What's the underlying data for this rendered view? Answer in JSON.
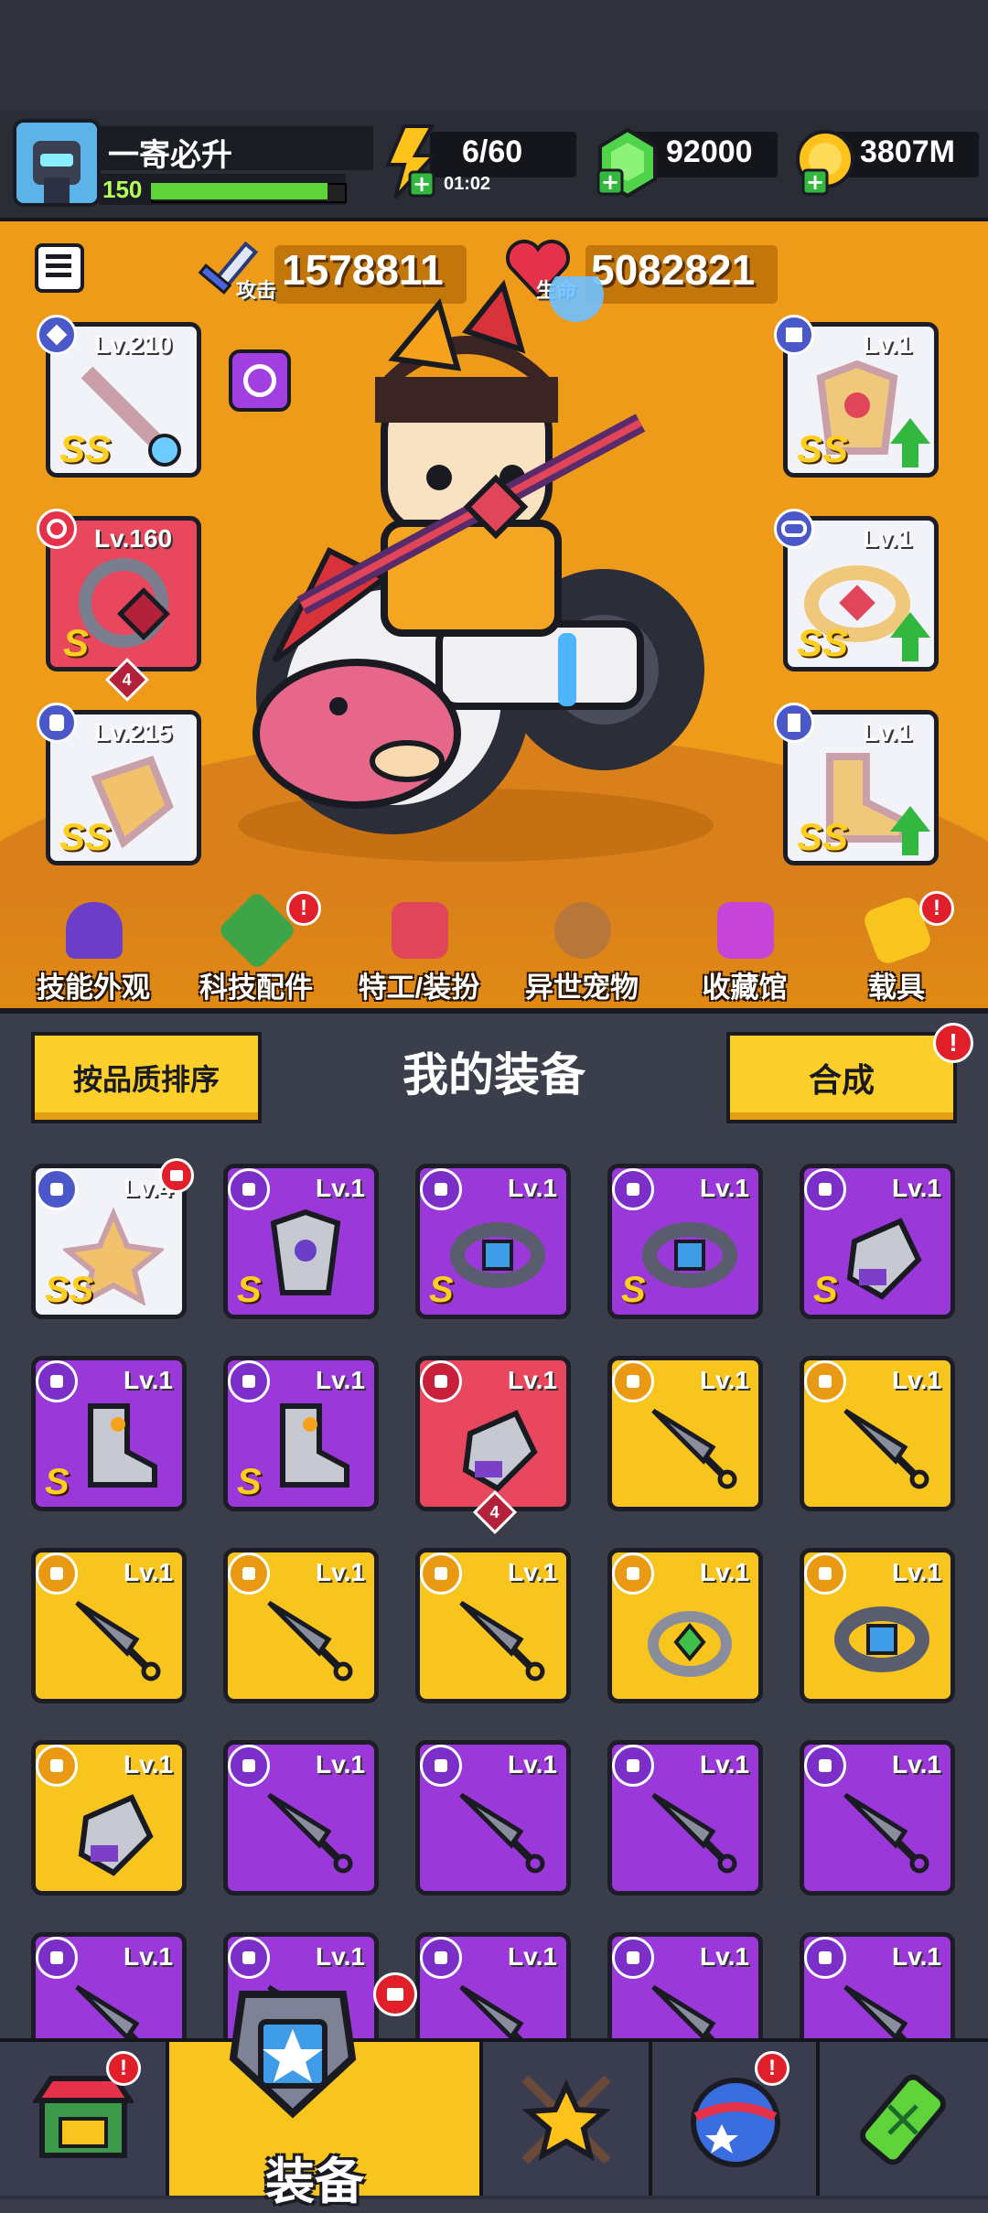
{
  "player": {
    "name": "一寄必升",
    "level": "150",
    "xp_progress": 0.92
  },
  "resources": {
    "energy": "6/60",
    "energy_timer": "01:02",
    "gems": "92000",
    "coins": "3807M"
  },
  "hero": {
    "attack_label": "攻击",
    "attack_value": "1578811",
    "hp_label": "生命",
    "hp_value": "5082821"
  },
  "equipped_slots": [
    {
      "level": "Lv.210",
      "grade": "SS",
      "icon": "sword-icon"
    },
    {
      "level": "Lv.160",
      "grade": "S",
      "stars": "4",
      "icon": "necklace-icon"
    },
    {
      "level": "Lv.215",
      "grade": "SS",
      "icon": "glove-icon"
    },
    {
      "level": "Lv.1",
      "grade": "SS",
      "icon": "armor-icon"
    },
    {
      "level": "Lv.1",
      "grade": "SS",
      "icon": "belt-icon"
    },
    {
      "level": "Lv.1",
      "grade": "SS",
      "icon": "boot-icon"
    }
  ],
  "features": [
    {
      "label": "技能外观",
      "icon": "hat-icon"
    },
    {
      "label": "科技配件",
      "icon": "hex-chip-icon",
      "alert": "!"
    },
    {
      "label": "特工/装扮",
      "icon": "agent-icon"
    },
    {
      "label": "异世宠物",
      "icon": "pet-icon"
    },
    {
      "label": "收藏馆",
      "icon": "treasure-chest-icon"
    },
    {
      "label": "载具",
      "icon": "skateboard-icon",
      "alert": "!"
    }
  ],
  "section": {
    "sort_button": "按品质排序",
    "title": "我的装备",
    "merge_button": "合成",
    "merge_alert": "!"
  },
  "inventory": [
    {
      "level": "Lv.4",
      "grade": "SS",
      "color": "white",
      "icon": "necklace-icon",
      "star": "alert"
    },
    {
      "level": "Lv.1",
      "grade": "S",
      "color": "purple",
      "icon": "armor-icon"
    },
    {
      "level": "Lv.1",
      "grade": "S",
      "color": "purple",
      "icon": "belt-icon"
    },
    {
      "level": "Lv.1",
      "grade": "S",
      "color": "purple",
      "icon": "belt-icon"
    },
    {
      "level": "Lv.1",
      "grade": "S",
      "color": "purple",
      "icon": "glove-icon"
    },
    {
      "level": "Lv.1",
      "grade": "S",
      "color": "purple",
      "icon": "boot-icon"
    },
    {
      "level": "Lv.1",
      "grade": "S",
      "color": "purple",
      "icon": "boot-icon"
    },
    {
      "level": "Lv.1",
      "grade": "",
      "color": "red",
      "icon": "glove-icon",
      "stars": "4"
    },
    {
      "level": "Lv.1",
      "grade": "",
      "color": "yellow",
      "icon": "kunai-icon"
    },
    {
      "level": "Lv.1",
      "grade": "",
      "color": "yellow",
      "icon": "kunai-icon"
    },
    {
      "level": "Lv.1",
      "grade": "",
      "color": "yellow",
      "icon": "kunai-icon"
    },
    {
      "level": "Lv.1",
      "grade": "",
      "color": "yellow",
      "icon": "kunai-icon"
    },
    {
      "level": "Lv.1",
      "grade": "",
      "color": "yellow",
      "icon": "kunai-icon"
    },
    {
      "level": "Lv.1",
      "grade": "",
      "color": "yellow",
      "icon": "ring-icon"
    },
    {
      "level": "Lv.1",
      "grade": "",
      "color": "yellow",
      "icon": "belt-icon"
    },
    {
      "level": "Lv.1",
      "grade": "",
      "color": "yellow",
      "icon": "glove-icon"
    },
    {
      "level": "Lv.1",
      "grade": "",
      "color": "purple",
      "icon": "kunai-icon"
    },
    {
      "level": "Lv.1",
      "grade": "",
      "color": "purple",
      "icon": "kunai-icon"
    },
    {
      "level": "Lv.1",
      "grade": "",
      "color": "purple",
      "icon": "kunai-icon"
    },
    {
      "level": "Lv.1",
      "grade": "",
      "color": "purple",
      "icon": "kunai-icon"
    },
    {
      "level": "Lv.1",
      "grade": "",
      "color": "purple",
      "icon": "kunai-icon"
    },
    {
      "level": "Lv.1",
      "grade": "",
      "color": "purple",
      "icon": "kunai-icon"
    },
    {
      "level": "Lv.1",
      "grade": "",
      "color": "purple",
      "icon": "kunai-icon"
    },
    {
      "level": "Lv.1",
      "grade": "",
      "color": "purple",
      "icon": "kunai-icon"
    },
    {
      "level": "Lv.1",
      "grade": "",
      "color": "purple",
      "icon": "kunai-icon"
    }
  ],
  "bottom_nav": {
    "equip_label": "装备",
    "tabs": [
      {
        "icon": "shop-icon",
        "alert": "!"
      },
      {
        "icon": "equipment-icon"
      },
      {
        "icon": "star-swords-icon"
      },
      {
        "icon": "planet-egg-icon",
        "alert": "!"
      },
      {
        "icon": "dna-capsule-icon"
      }
    ]
  }
}
